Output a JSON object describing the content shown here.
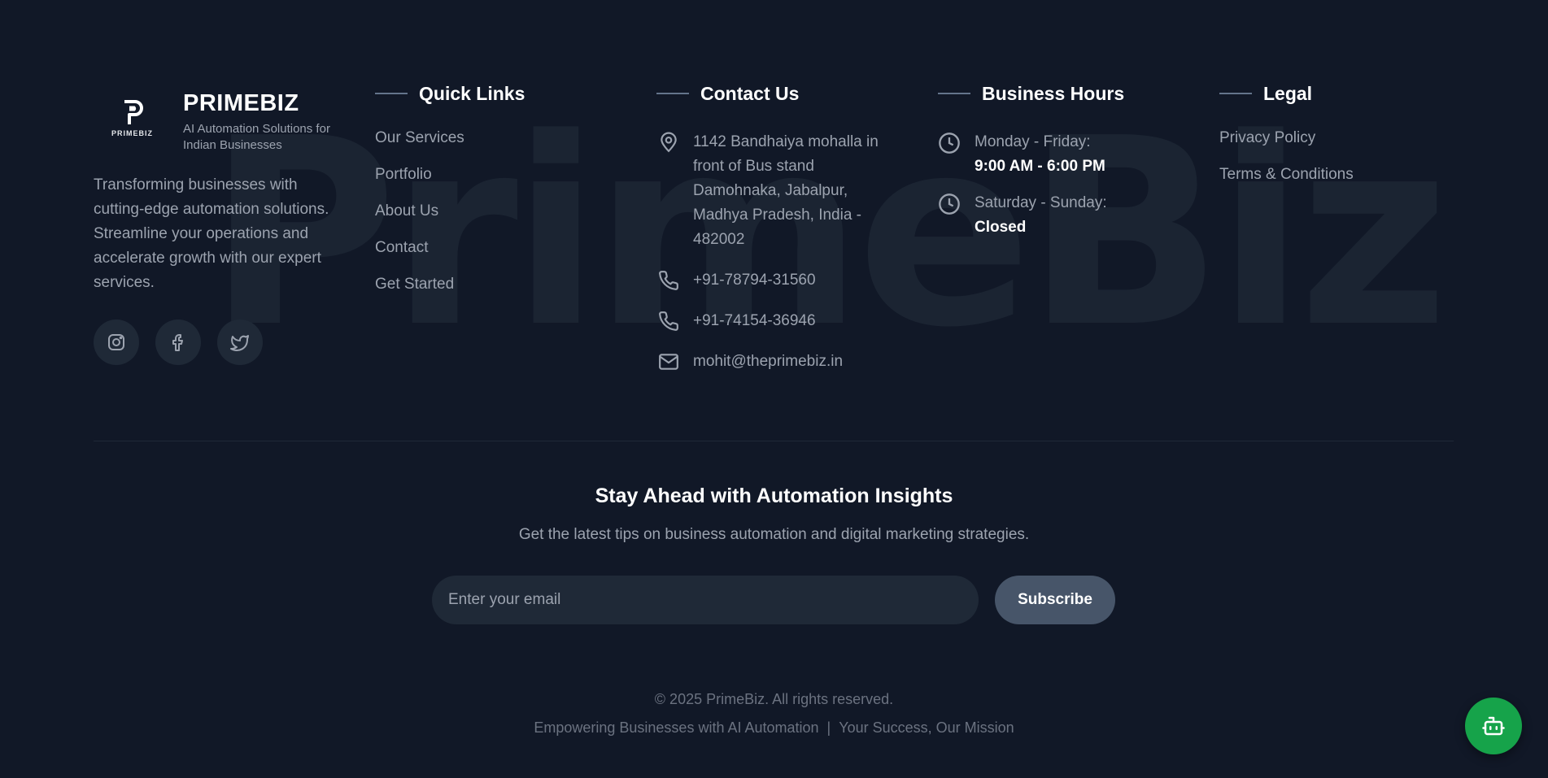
{
  "watermark": "PrimeBiz",
  "brand": {
    "logo_text": "PRIMEBIZ",
    "name": "PRIMEBIZ",
    "tagline": "AI Automation Solutions for Indian Businesses",
    "description": "Transforming businesses with cutting-edge automation solutions. Streamline your operations and accelerate growth with our expert services.",
    "socials": [
      "instagram-icon",
      "facebook-icon",
      "twitter-icon"
    ]
  },
  "quick_links": {
    "title": "Quick Links",
    "items": [
      "Our Services",
      "Portfolio",
      "About Us",
      "Contact",
      "Get Started"
    ]
  },
  "contact": {
    "title": "Contact Us",
    "address": "1142 Bandhaiya mohalla in front of Bus stand Damohnaka, Jabalpur, Madhya Pradesh, India - 482002",
    "phone1": "+91-78794-31560",
    "phone2": "+91-74154-36946",
    "email": "mohit@theprimebiz.in"
  },
  "hours": {
    "title": "Business Hours",
    "weekday_label": "Monday - Friday:",
    "weekday_value": "9:00 AM - 6:00 PM",
    "weekend_label": "Saturday - Sunday:",
    "weekend_value": "Closed"
  },
  "legal": {
    "title": "Legal",
    "items": [
      "Privacy Policy",
      "Terms & Conditions"
    ]
  },
  "newsletter": {
    "title": "Stay Ahead with Automation Insights",
    "subtitle": "Get the latest tips on business automation and digital marketing strategies.",
    "placeholder": "Enter your email",
    "button": "Subscribe"
  },
  "footer": {
    "copyright": "© 2025 PrimeBiz. All rights reserved.",
    "mission_left": "Empowering Businesses with AI Automation",
    "separator": "|",
    "mission_right": "Your Success, Our Mission"
  },
  "colors": {
    "background": "#111827",
    "accent_bar": "#64748b",
    "chat_button": "#16a34a"
  }
}
